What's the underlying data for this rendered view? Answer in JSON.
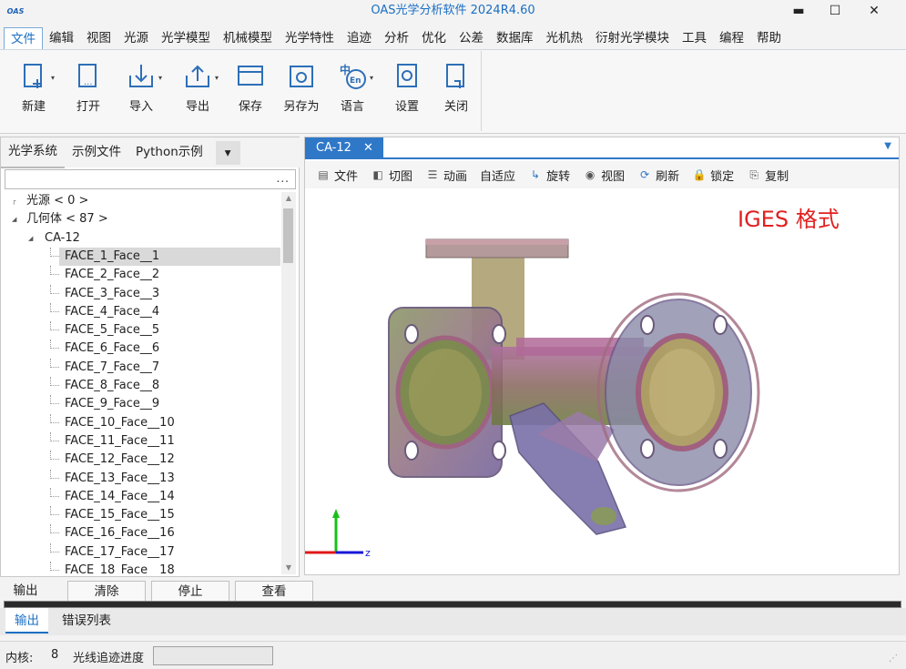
{
  "app": {
    "title": "OAS光学分析软件 2024R4.60",
    "logo_text": "OAS",
    "window_controls": {
      "minimize": "▬",
      "maximize": "☐",
      "close": "✕"
    }
  },
  "menu": [
    "文件",
    "编辑",
    "视图",
    "光源",
    "光学模型",
    "机械模型",
    "光学特性",
    "追迹",
    "分析",
    "优化",
    "公差",
    "数据库",
    "光机热",
    "衍射光学模块",
    "工具",
    "编程",
    "帮助"
  ],
  "ribbon": [
    {
      "label": "新建",
      "icon": "new-file-icon",
      "dropdown": true
    },
    {
      "label": "打开",
      "icon": "open-file-icon",
      "dropdown": false
    },
    {
      "label": "导入",
      "icon": "import-icon",
      "dropdown": true
    },
    {
      "label": "导出",
      "icon": "export-icon",
      "dropdown": true
    },
    {
      "label": "保存",
      "icon": "save-icon",
      "dropdown": false
    },
    {
      "label": "另存为",
      "icon": "save-as-icon",
      "dropdown": false
    },
    {
      "label": "语言",
      "icon": "language-icon",
      "dropdown": true
    },
    {
      "label": "设置",
      "icon": "settings-icon",
      "dropdown": false
    },
    {
      "label": "关闭",
      "icon": "close-file-icon",
      "dropdown": false
    }
  ],
  "left_panel": {
    "tabs": [
      "光学系统",
      "示例文件",
      "Python示例"
    ],
    "tab_more": "▾",
    "search_btn": "...",
    "tree": [
      {
        "text": "光源 < 0 >",
        "level": 0,
        "expander": ""
      },
      {
        "text": "几何体 < 87 >",
        "level": 0,
        "expander": "◢"
      },
      {
        "text": "CA-12",
        "level": 1,
        "expander": "◢"
      },
      {
        "text": "FACE_1_Face__1",
        "level": 2,
        "selected": true
      },
      {
        "text": "FACE_2_Face__2",
        "level": 2
      },
      {
        "text": "FACE_3_Face__3",
        "level": 2
      },
      {
        "text": "FACE_4_Face__4",
        "level": 2
      },
      {
        "text": "FACE_5_Face__5",
        "level": 2
      },
      {
        "text": "FACE_6_Face__6",
        "level": 2
      },
      {
        "text": "FACE_7_Face__7",
        "level": 2
      },
      {
        "text": "FACE_8_Face__8",
        "level": 2
      },
      {
        "text": "FACE_9_Face__9",
        "level": 2
      },
      {
        "text": "FACE_10_Face__10",
        "level": 2
      },
      {
        "text": "FACE_11_Face__11",
        "level": 2
      },
      {
        "text": "FACE_12_Face__12",
        "level": 2
      },
      {
        "text": "FACE_13_Face__13",
        "level": 2
      },
      {
        "text": "FACE_14_Face__14",
        "level": 2
      },
      {
        "text": "FACE_15_Face__15",
        "level": 2
      },
      {
        "text": "FACE_16_Face__16",
        "level": 2
      },
      {
        "text": "FACE_17_Face__17",
        "level": 2
      },
      {
        "text": "FACE_18_Face__18",
        "level": 2
      }
    ]
  },
  "doc": {
    "tab_label": "CA-12",
    "tab_close": "✕",
    "toolbar": [
      {
        "label": "文件",
        "icon": "document-icon",
        "glyph": "▤"
      },
      {
        "label": "切图",
        "icon": "cut-view-icon",
        "glyph": "◧"
      },
      {
        "label": "动画",
        "icon": "animation-icon",
        "glyph": "☰"
      },
      {
        "label": "自适应",
        "icon": "",
        "glyph": ""
      },
      {
        "label": "旋转",
        "icon": "rotate-icon",
        "glyph": "↳"
      },
      {
        "label": "视图",
        "icon": "view-icon",
        "glyph": "◉"
      },
      {
        "label": "刷新",
        "icon": "refresh-icon",
        "glyph": "⟳"
      },
      {
        "label": "锁定",
        "icon": "lock-icon",
        "glyph": "🔒"
      },
      {
        "label": "复制",
        "icon": "copy-icon",
        "glyph": "⎘"
      }
    ],
    "viewport_label": "IGES 格式",
    "axes": {
      "z_label": "z"
    }
  },
  "bottom": {
    "output_label": "输出",
    "buttons": [
      "清除",
      "停止",
      "查看"
    ],
    "tabs": [
      "输出",
      "错误列表"
    ]
  },
  "status": {
    "core_label": "内核:",
    "core_value": "8",
    "progress_label": "光线追迹进度",
    "progress": 0
  },
  "colors": {
    "accent": "#2f78c8",
    "title": "#1a6fc4",
    "iges": "#e02020"
  }
}
